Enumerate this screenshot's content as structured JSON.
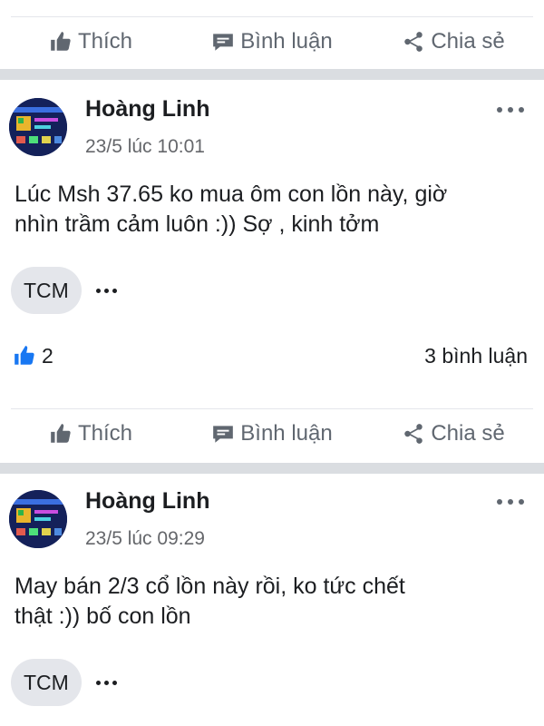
{
  "actions": {
    "like": "Thích",
    "comment": "Bình luận",
    "share": "Chia sẻ"
  },
  "posts": [
    {
      "author": "Hoàng Linh",
      "timestamp": "23/5 lúc 10:01",
      "text_lines": [
        "Lúc Msh 37.65 ko mua ôm con lồn này, giờ",
        "nhìn trầm cảm luôn :)) Sợ , kinh tởm"
      ],
      "tag": "TCM",
      "likes": "2",
      "comments": "3 bình luận"
    },
    {
      "author": "Hoàng Linh",
      "timestamp": "23/5 lúc 09:29",
      "text_lines": [
        "May bán 2/3 cổ lồn này rồi, ko tức chết",
        "thật :)) bố con lồn"
      ],
      "tag": "TCM"
    }
  ],
  "colors": {
    "like_blue": "#1877f2",
    "divider_band": "#dadde1",
    "secondary_text": "#65676b"
  },
  "icons": {
    "like": "thumbs-up-icon",
    "comment": "speech-bubble-icon",
    "share": "share-icon",
    "more": "more-dots-icon"
  }
}
